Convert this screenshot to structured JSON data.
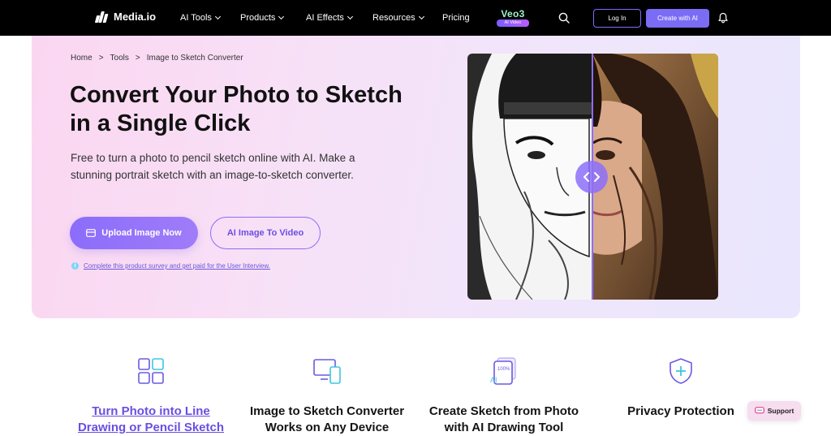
{
  "nav": {
    "brand": "Media.io",
    "items": [
      {
        "label": "AI Tools",
        "dropdown": true
      },
      {
        "label": "Products",
        "dropdown": true
      },
      {
        "label": "AI Effects",
        "dropdown": true
      },
      {
        "label": "Resources",
        "dropdown": true
      },
      {
        "label": "Pricing",
        "dropdown": false
      }
    ],
    "veo_title": "Veo3",
    "veo_badge": "AI Video",
    "login_label": "Log In",
    "create_label": "Create with AI"
  },
  "breadcrumb": [
    "Home",
    "Tools",
    "Image to Sketch Converter"
  ],
  "hero": {
    "title": "Convert Your Photo to Sketch in a Single Click",
    "description": "Free to turn a photo to pencil sketch online with AI. Make a stunning portrait sketch with an image-to-sketch converter.",
    "upload_label": "Upload Image Now",
    "video_label": "AI Image To Video",
    "survey_text": "Complete this product survey and get paid for the User Interview."
  },
  "features": [
    {
      "title": "Turn Photo into Line Drawing or Pencil Sketch",
      "icon": "grid-icon",
      "link": true
    },
    {
      "title": "Image to Sketch Converter Works on Any Device",
      "icon": "devices-icon",
      "link": false
    },
    {
      "title": "Create Sketch from Photo with AI Drawing Tool",
      "icon": "ai-document-icon",
      "link": false
    },
    {
      "title": "Privacy Protection",
      "icon": "shield-plus-icon",
      "link": false
    }
  ],
  "support_label": "Support",
  "colors": {
    "accent": "#8b6dfa",
    "nav_bg": "#000000",
    "hero_pink": "#fbd6f1",
    "hero_lavender": "#e9e6fd"
  }
}
